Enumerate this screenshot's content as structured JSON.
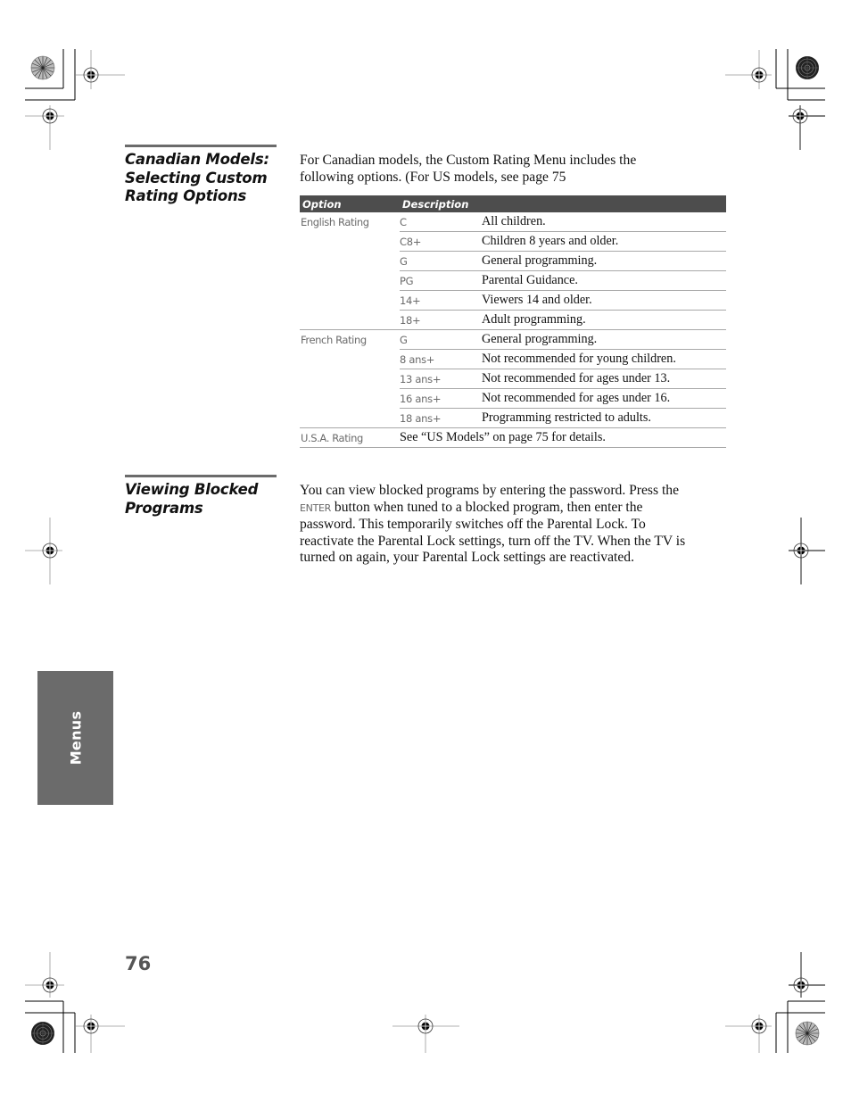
{
  "sections": [
    {
      "heading_lines": [
        "Canadian Models:",
        "Selecting Custom",
        "Rating Options"
      ],
      "intro_lines": [
        "For Canadian models, the Custom Rating Menu includes the",
        "following options. (For US models, see page 75"
      ]
    },
    {
      "heading_lines": [
        "Viewing Blocked",
        "Programs"
      ],
      "body": {
        "line1": "You can view blocked programs by entering the password. Press the",
        "enter_key": "ENTER",
        "line2_rest": " button when tuned to a blocked program, then enter the",
        "line3": "password. This temporarily switches off the Parental Lock. To",
        "line4": "reactivate the Parental Lock settings, turn off the TV. When the TV is",
        "line5": "turned on again, your Parental Lock settings are reactivated."
      }
    }
  ],
  "table": {
    "headers": {
      "option": "Option",
      "description": "Description"
    },
    "groups": [
      {
        "option": "English Rating",
        "rows": [
          {
            "code": "C",
            "desc": "All children."
          },
          {
            "code": "C8+",
            "desc": "Children 8 years and older."
          },
          {
            "code": "G",
            "desc": "General programming."
          },
          {
            "code": "PG",
            "desc": "Parental Guidance."
          },
          {
            "code": "14+",
            "desc": "Viewers 14 and older."
          },
          {
            "code": "18+",
            "desc": "Adult programming."
          }
        ]
      },
      {
        "option": "French Rating",
        "rows": [
          {
            "code": "G",
            "desc": "General programming."
          },
          {
            "code": "8 ans+",
            "desc": "Not recommended for young children."
          },
          {
            "code": "13 ans+",
            "desc": "Not recommended for ages under 13."
          },
          {
            "code": "16 ans+",
            "desc": "Not recommended for ages under 16."
          },
          {
            "code": "18 ans+",
            "desc": "Programming restricted to adults."
          }
        ]
      },
      {
        "option": "U.S.A. Rating",
        "full_desc": "See “US Models” on page 75 for details."
      }
    ]
  },
  "side_tab": {
    "label": "Menus"
  },
  "footer": {
    "page_number": "76"
  },
  "colors": {
    "rule": "#6b6b6b",
    "table_header_bg": "#4d4d4d",
    "side_tab_bg": "#6b6b6b"
  }
}
